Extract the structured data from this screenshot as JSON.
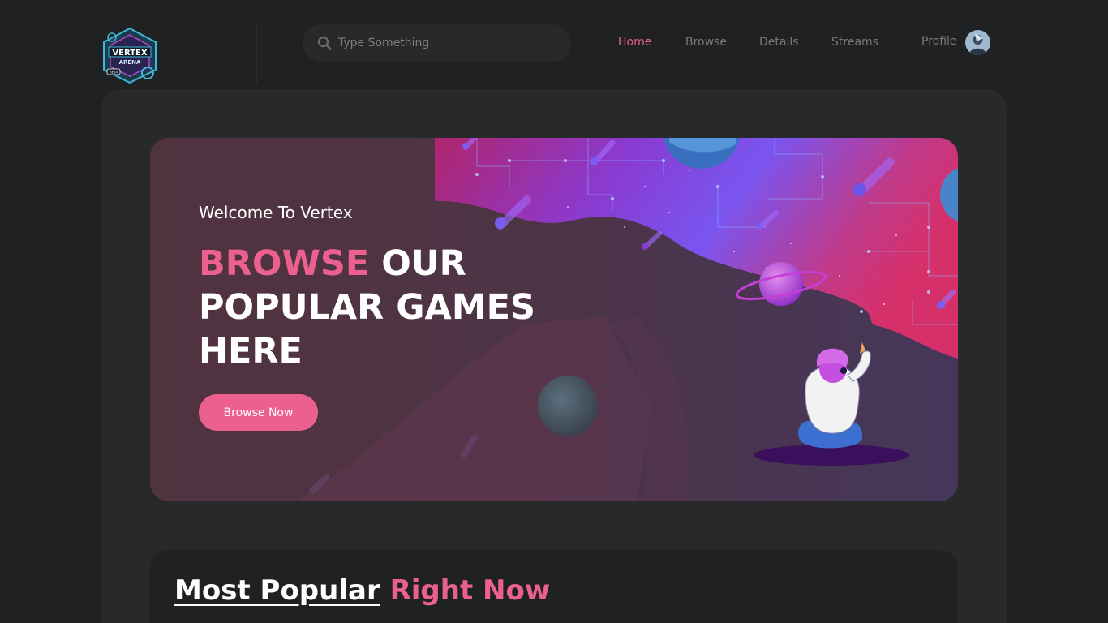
{
  "logo": {
    "text_line1": "VERTEX",
    "text_line2": "ARENA",
    "text_badge": "BETA"
  },
  "search": {
    "placeholder": "Type Something",
    "icon": "search-icon"
  },
  "nav": {
    "items": [
      {
        "label": "Home",
        "active": true
      },
      {
        "label": "Browse",
        "active": false
      },
      {
        "label": "Details",
        "active": false
      },
      {
        "label": "Streams",
        "active": false
      },
      {
        "label": "Profile",
        "active": false
      }
    ]
  },
  "banner": {
    "welcome": "Welcome To Vertex",
    "headline_accent": "BROWSE",
    "headline_rest": "OUR POPULAR GAMES HERE",
    "button_label": "Browse Now"
  },
  "popular": {
    "title_main": "Most Popular",
    "title_accent": "Right Now"
  },
  "colors": {
    "accent": "#ec6090",
    "background": "#1f2122",
    "panel": "#27292a",
    "nav_text": "#7a7a7a"
  }
}
